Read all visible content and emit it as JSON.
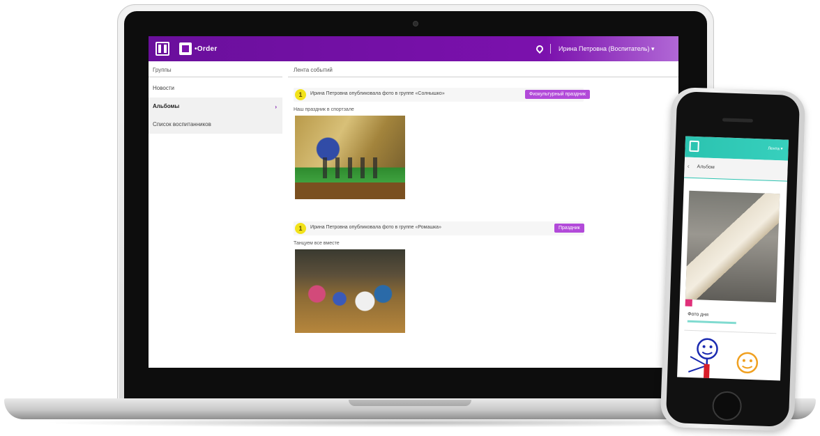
{
  "app": {
    "logo_text": "•Order",
    "user_menu": "Ирина Петровна (Воспитатель) ▾"
  },
  "sidebar": {
    "header": "Группы",
    "items": [
      {
        "label": "Новости"
      },
      {
        "label": "Альбомы",
        "arrow": "›"
      },
      {
        "label": "Список воспитанников"
      }
    ]
  },
  "feed": {
    "header": "Лента событий",
    "posts": [
      {
        "badge": "1",
        "meta": "Ирина Петровна опубликовала фото в группе «Солнышко»",
        "tag": "Физкультурный праздник",
        "caption": "Наш праздник в спортзале"
      },
      {
        "badge": "1",
        "meta": "Ирина Петровна опубликовала фото в группе «Ромашка»",
        "tag": "Праздник",
        "caption": "Танцуем все вместе"
      }
    ]
  },
  "phone": {
    "topbar_text": "Лента ▾",
    "subtitle": "Альбом",
    "chevron": "‹",
    "caption": "Фото дня"
  },
  "colors": {
    "primary_purple": "#7b11ad",
    "tag_purple": "#b24ad9",
    "badge_yellow": "#f2e21a",
    "phone_teal": "#2bc3b0"
  },
  "icons": [
    "menu-icon",
    "logo-icon",
    "location-pin-icon",
    "chevron-right-icon",
    "chevron-left-icon",
    "home-button-icon"
  ]
}
